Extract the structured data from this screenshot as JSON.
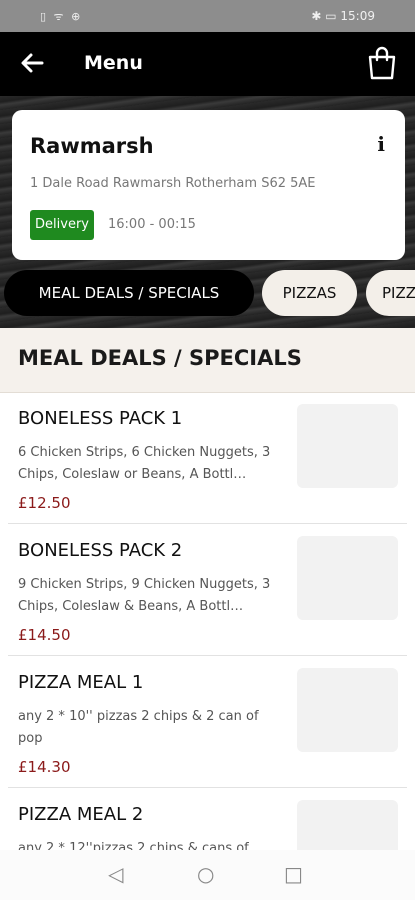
{
  "statusbar": {
    "left_icons": "▯ ᯤ ⊕",
    "right_text": "✱ ▭ 15:09"
  },
  "appbar": {
    "back_icon": "back-arrow-icon",
    "title": "Menu",
    "cart_icon": "shopping-bag-icon"
  },
  "store": {
    "name": "Rawmarsh",
    "address": "1 Dale Road Rawmarsh Rotherham S62 5AE",
    "badge": "Delivery",
    "hours": "16:00 - 00:15",
    "info_label": "i"
  },
  "categories": [
    "MEAL DEALS / SPECIALS",
    "PIZZAS",
    "PIZZ"
  ],
  "section_title": "MEAL DEALS / SPECIALS",
  "items": [
    {
      "title": "BONELESS PACK 1",
      "description": "6 Chicken Strips, 6 Chicken Nuggets, 3 Chips, Coleslaw or Beans, A Bottl…",
      "price": "£12.50"
    },
    {
      "title": "BONELESS PACK 2",
      "description": "9 Chicken Strips, 9 Chicken Nuggets, 3 Chips, Coleslaw & Beans, A Bottl…",
      "price": "£14.50"
    },
    {
      "title": "PIZZA MEAL 1",
      "description": "any 2 * 10'' pizzas 2 chips & 2 can of pop",
      "price": "£14.30"
    },
    {
      "title": "PIZZA MEAL 2",
      "description": "any 2 * 12''pizzas 2 chips & cans of",
      "price": ""
    }
  ],
  "navbar": {
    "back": "◁",
    "home": "○",
    "recent": "□"
  },
  "colors": {
    "appbar": "#000000",
    "delivery_badge": "#1f8a1f",
    "price": "#8b1a1a",
    "section_bg": "#f5f1ec"
  }
}
